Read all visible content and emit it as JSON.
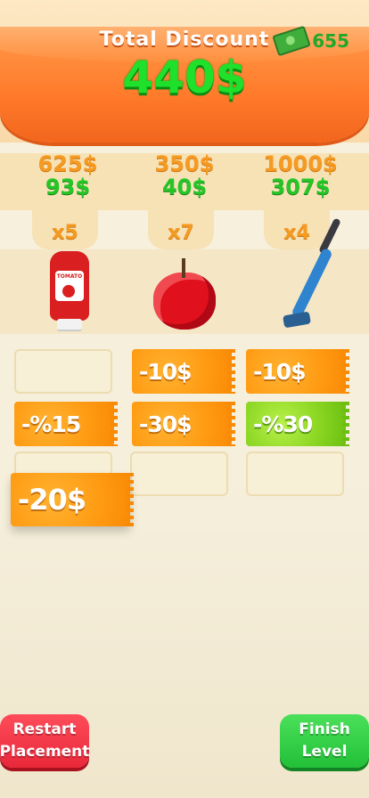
{
  "header": {
    "title": "Total Discount",
    "amount": "440$",
    "cash": "655"
  },
  "products": [
    {
      "name": "ketchup",
      "original_price": "625$",
      "discounted_price": "93$",
      "quantity": "x5"
    },
    {
      "name": "apple",
      "original_price": "350$",
      "discounted_price": "40$",
      "quantity": "x7"
    },
    {
      "name": "vacuum",
      "original_price": "1000$",
      "discounted_price": "307$",
      "quantity": "x4"
    }
  ],
  "ketchup_label": "TOMATO",
  "coupons": {
    "c1": "-10$",
    "c2": "-10$",
    "c3": "-%15",
    "c4": "-30$",
    "c5": "-%30",
    "dragging": "-20$"
  },
  "buttons": {
    "restart": "Restart Placement",
    "finish": "Finish Level"
  },
  "colors": {
    "banner": "#ff7a2a",
    "discount_green": "#1fe02a",
    "coupon_orange": "#ff9a12",
    "coupon_green": "#88d420",
    "restart_red": "#e8283a",
    "finish_green": "#22c038"
  }
}
